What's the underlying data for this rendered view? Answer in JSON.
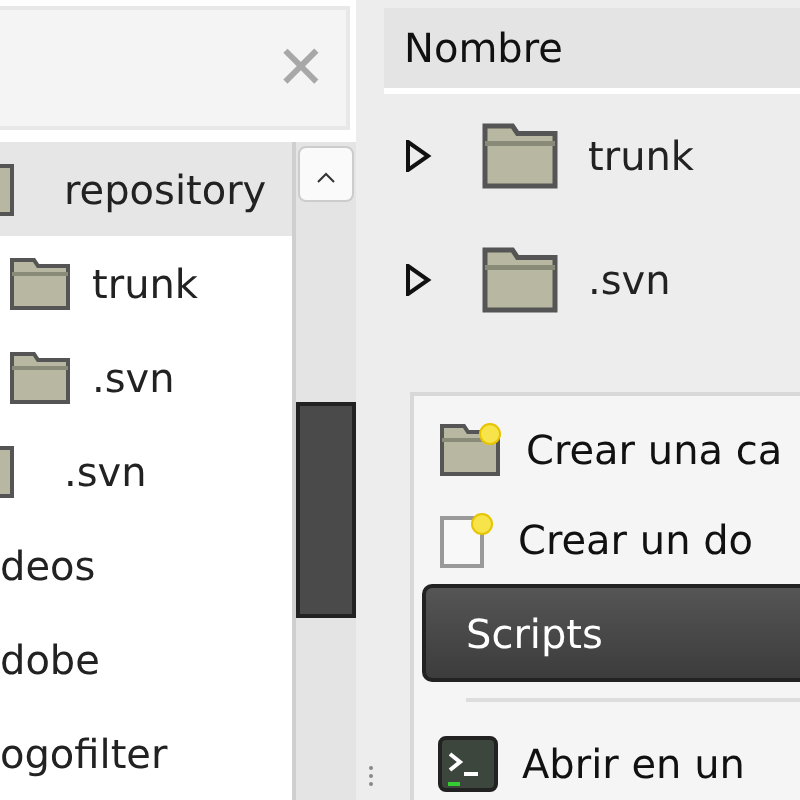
{
  "sidebar": {
    "close_label": "✕",
    "items": [
      {
        "kind": "folder",
        "label": "repository",
        "selected": true,
        "children": [
          {
            "label": "trunk",
            "selected": false
          },
          {
            "label": ".svn",
            "selected": false
          }
        ]
      },
      {
        "kind": "folder",
        "label": ".svn",
        "selected": false
      },
      {
        "kind": "plain",
        "label": "deos",
        "selected": false
      },
      {
        "kind": "plain",
        "label": "dobe",
        "selected": false
      },
      {
        "kind": "plain",
        "label": "ogofilter",
        "selected": false
      }
    ]
  },
  "file_list": {
    "column": "Nombre",
    "rows": [
      {
        "name": "trunk",
        "expanded": false
      },
      {
        "name": ".svn",
        "expanded": false
      }
    ]
  },
  "context_menu": [
    {
      "kind": "new-folder",
      "label": "Crear una ca",
      "selected": false
    },
    {
      "kind": "new-document",
      "label": "Crear un do",
      "selected": false
    },
    {
      "kind": "plain",
      "label": "Scripts",
      "selected": true
    },
    {
      "kind": "separator"
    },
    {
      "kind": "terminal",
      "label": "Abrir en un",
      "selected": false
    }
  ]
}
